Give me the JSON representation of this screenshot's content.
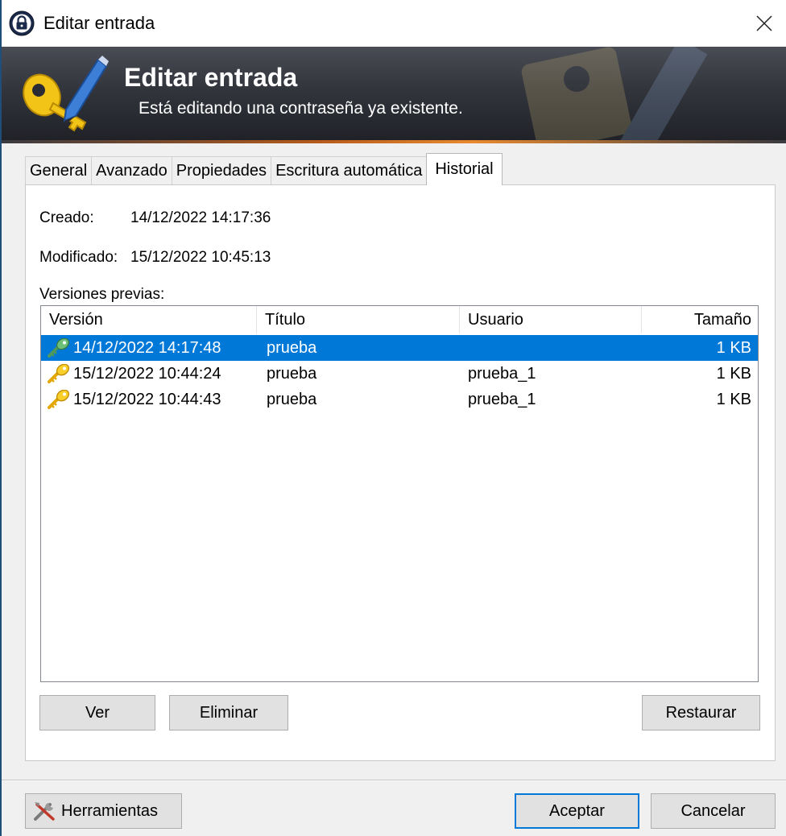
{
  "window": {
    "title": "Editar entrada",
    "close_symbol": "✕"
  },
  "banner": {
    "title": "Editar entrada",
    "subtitle": "Está editando una contraseña ya existente."
  },
  "tabs": [
    {
      "label": "General",
      "active": false
    },
    {
      "label": "Avanzado",
      "active": false
    },
    {
      "label": "Propiedades",
      "active": false
    },
    {
      "label": "Escritura automática",
      "active": false
    },
    {
      "label": "Historial",
      "active": true
    }
  ],
  "history": {
    "created_label": "Creado:",
    "created_value": "14/12/2022 14:17:36",
    "modified_label": "Modificado:",
    "modified_value": "15/12/2022 10:45:13",
    "previous_versions_label": "Versiones previas:",
    "columns": [
      "Versión",
      "Título",
      "Usuario",
      "Tamaño"
    ],
    "rows": [
      {
        "version": "14/12/2022 14:17:48",
        "title": "prueba",
        "user": "",
        "size": "1 KB",
        "selected": true,
        "icon": "green-key-icon"
      },
      {
        "version": "15/12/2022 10:44:24",
        "title": "prueba",
        "user": "prueba_1",
        "size": "1 KB",
        "selected": false,
        "icon": "yellow-key-icon"
      },
      {
        "version": "15/12/2022 10:44:43",
        "title": "prueba",
        "user": "prueba_1",
        "size": "1 KB",
        "selected": false,
        "icon": "yellow-key-icon"
      }
    ],
    "buttons": {
      "view": "Ver",
      "delete": "Eliminar",
      "restore": "Restaurar"
    }
  },
  "footer": {
    "tools": "Herramientas",
    "ok": "Aceptar",
    "cancel": "Cancelar"
  },
  "colors": {
    "selection": "#0078d7",
    "default_button_border": "#0078d7",
    "banner_dark": "#2a2c33",
    "accent_line": "#e8892f"
  }
}
